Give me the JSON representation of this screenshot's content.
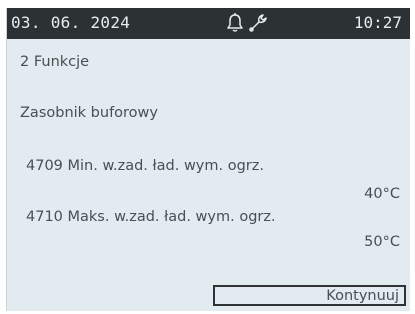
{
  "status_bar": {
    "date": "03. 06. 2024",
    "time": "10:27",
    "icons": [
      "bell-icon",
      "wrench-icon"
    ]
  },
  "menu": {
    "title": "2 Funkcje"
  },
  "section": {
    "title": "Zasobnik buforowy"
  },
  "parameters": [
    {
      "label": "4709 Min. w.zad. ład. wym. ogrz.",
      "value": "40°C"
    },
    {
      "label": "4710 Maks. w.zad. ład. wym. ogrz.",
      "value": "50°C"
    }
  ],
  "footer": {
    "continue_label": "Kontynuuj"
  },
  "colors": {
    "screen_background": "#e1ebf0",
    "status_bar_background": "#2c3134",
    "text": "#4a4f53"
  }
}
